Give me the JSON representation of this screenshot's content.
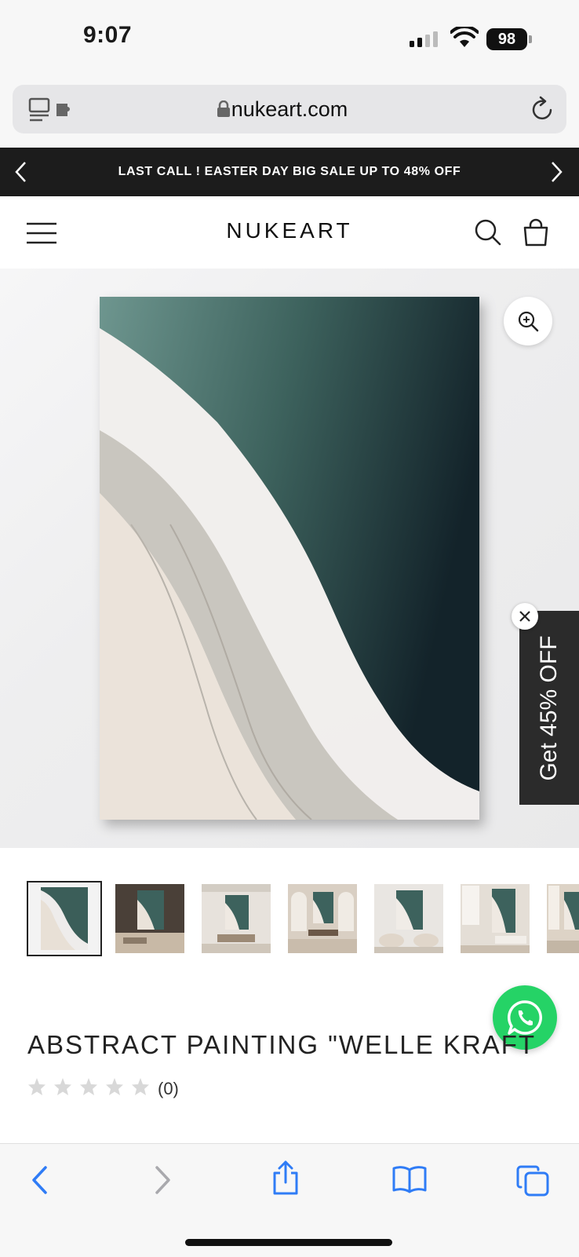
{
  "status_bar": {
    "time": "9:07",
    "battery": "98"
  },
  "browser": {
    "url": "nukeart.com"
  },
  "promo_banner": {
    "text": "LAST CALL ! EASTER DAY BIG SALE UP TO 48% OFF"
  },
  "header": {
    "logo": "NUKEART"
  },
  "discount_tab": {
    "label": "Get 45% OFF"
  },
  "product": {
    "title": "ABSTRACT PAINTING \"WELLE KRAFT",
    "rating_stars": 0,
    "review_count": "(0)"
  },
  "thumbnails": [
    {
      "name": "thumb-painting",
      "selected": true
    },
    {
      "name": "thumb-room-dark"
    },
    {
      "name": "thumb-room-loft"
    },
    {
      "name": "thumb-room-arches"
    },
    {
      "name": "thumb-room-lounge"
    },
    {
      "name": "thumb-room-tall-windows"
    },
    {
      "name": "thumb-room-partial"
    }
  ],
  "colors": {
    "banner_bg": "#1c1c1c",
    "whatsapp_green": "#25d366",
    "discount_tab_bg": "#2b2b2b",
    "ios_blue": "#2f7cf6"
  }
}
